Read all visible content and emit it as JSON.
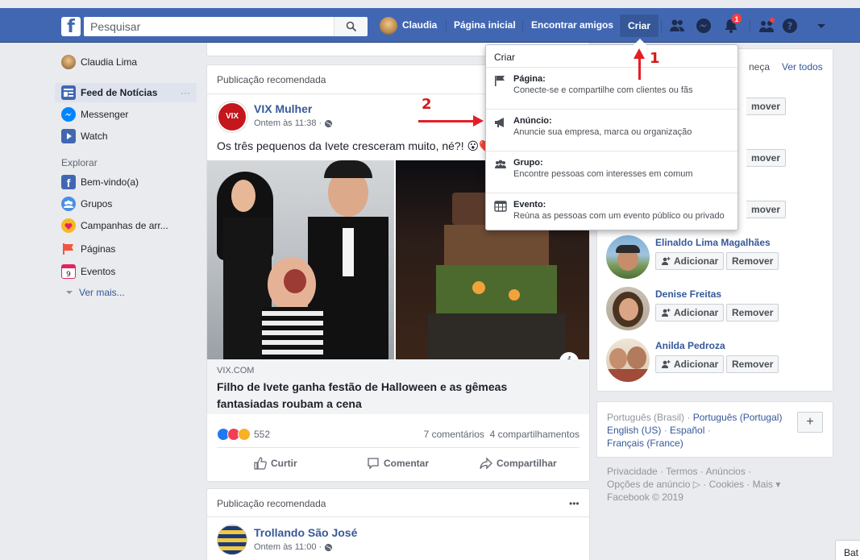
{
  "topbar": {
    "search_placeholder": "Pesquisar",
    "user_name": "Claudia",
    "home_label": "Página inicial",
    "find_friends_label": "Encontrar amigos",
    "create_label": "Criar",
    "notifications_count": "1",
    "brand_color": "#4267b2"
  },
  "sidebar": {
    "profile_name": "Claudia Lima",
    "feed_label": "Feed de Notícias",
    "feed_more": "···",
    "messenger_label": "Messenger",
    "watch_label": "Watch",
    "explore_header": "Explorar",
    "explore_items": [
      "Bem-vindo(a)",
      "Grupos",
      "Campanhas de arr...",
      "Páginas",
      "Eventos"
    ],
    "see_more": "Ver mais..."
  },
  "post1": {
    "header": "Publicação recomendada",
    "author": "VIX Mulher",
    "time": "Ontem às 11:38 ·",
    "text": "Os três pequenos da Ivete cresceram muito, né?! 😮❤️",
    "link_domain": "VIX.COM",
    "link_title": "Filho de Ivete ganha festão de Halloween e as gêmeas fantasiadas roubam a cena",
    "reactions_count": "552",
    "comments_shares": "7 comentários  4 compartilhamentos",
    "like_label": "Curtir",
    "comment_label": "Comentar",
    "share_label": "Compartilhar",
    "info_icon": "i"
  },
  "post2": {
    "header": "Publicação recomendada",
    "more": "•••",
    "author": "Trollando São José",
    "time": "Ontem às 11:00 ·"
  },
  "dropdown": {
    "title": "Criar",
    "items": [
      {
        "title": "Página:",
        "desc": "Conecte-se e compartilhe com clientes ou fãs",
        "icon": "flag-icon"
      },
      {
        "title": "Anúncio:",
        "desc": "Anuncie sua empresa, marca ou organização",
        "icon": "megaphone-icon"
      },
      {
        "title": "Grupo:",
        "desc": "Encontre pessoas com interesses em comum",
        "icon": "group-icon"
      },
      {
        "title": "Evento:",
        "desc": "Reúna as pessoas com um evento público ou privado",
        "icon": "calendar-icon"
      }
    ]
  },
  "annotations": {
    "arrow1_num": "1",
    "arrow2_num": "2"
  },
  "pymk": {
    "header_partial": "neça",
    "see_all": "Ver todos",
    "add_label": "Adicionar",
    "remove_label": "Remover",
    "partial_remove": [
      "mover",
      "mover",
      "mover",
      "mover"
    ],
    "people": [
      "Elinaldo Lima Magalhães",
      "Denise Freitas",
      "Anilda Pedroza"
    ]
  },
  "languages": {
    "current": "Português (Brasil) ·",
    "links": [
      "Português (Portugal)",
      "English (US)",
      "Español",
      "Français (France)"
    ],
    "add": "+"
  },
  "footer": {
    "line1": "Privacidade · Termos · Anúncios ·",
    "line2": "Opções de anúncio ▷ · Cookies · Mais ▾",
    "line3": "Facebook © 2019"
  },
  "chat_tab": "Bat"
}
